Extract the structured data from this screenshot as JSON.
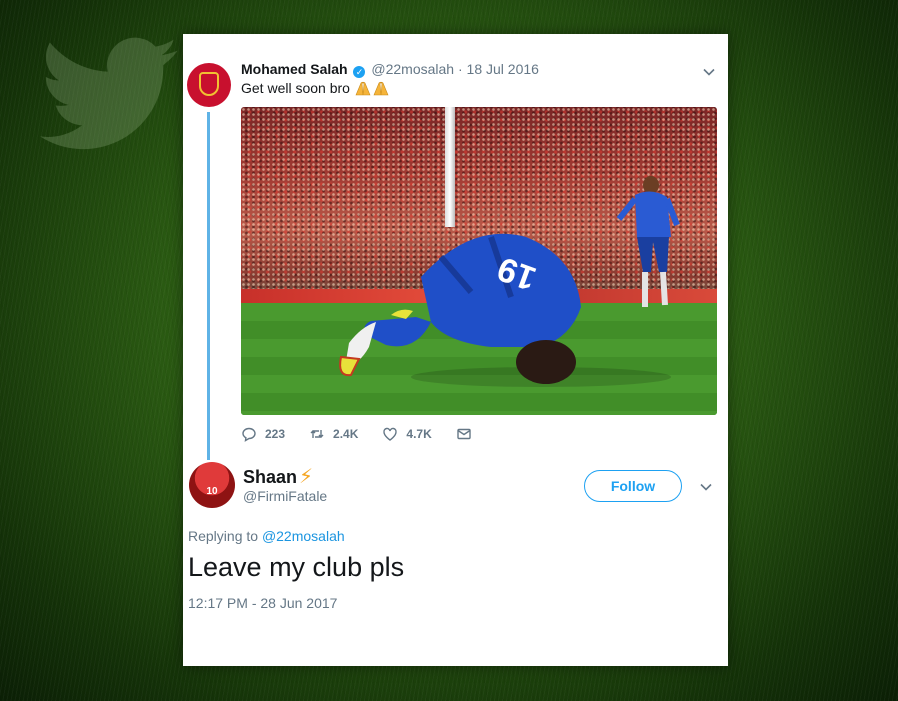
{
  "colors": {
    "accent": "#1da1f2",
    "link": "#1b95e0",
    "muted": "#657786",
    "thread_line": "#5fb3e6"
  },
  "background": {
    "icon": "twitter-bird-icon"
  },
  "tweet_1": {
    "name": "Mohamed Salah",
    "handle": "@22mosalah",
    "separator": "·",
    "date": "18 Jul 2016",
    "text": "Get well soon bro",
    "emoji": [
      "folded-hands-emoji",
      "folded-hands-emoji"
    ],
    "stats": {
      "replies": "223",
      "retweets": "2.4K",
      "likes": "4.7K"
    }
  },
  "tweet_2": {
    "name": "Shaan",
    "name_emoji": "⚡",
    "handle": "@FirmiFatale",
    "follow_label": "Follow",
    "replying_prefix": "Replying to",
    "replying_to": "@22mosalah",
    "text": "Leave my club pls",
    "timestamp": "12:17 PM - 28 Jun 2017"
  }
}
